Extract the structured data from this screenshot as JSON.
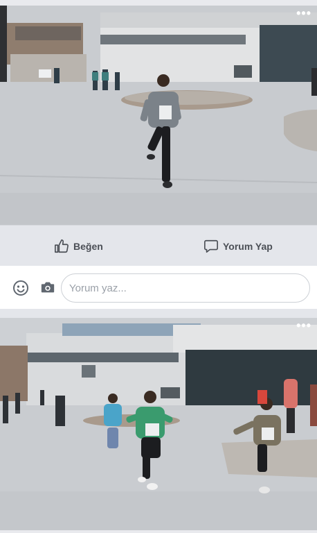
{
  "post1": {
    "photo_alt": "Children running on a paved plaza in front of a building",
    "more_label": "•••"
  },
  "actions": {
    "like_label": "Beğen",
    "comment_label": "Yorum Yap"
  },
  "comment_box": {
    "placeholder": "Yorum yaz..."
  },
  "post2": {
    "more_label": "•••"
  },
  "icons": {
    "like": "thumbs-up-icon",
    "comment": "speech-bubble-icon",
    "emoji": "smiley-icon",
    "camera": "camera-icon",
    "more": "more-dots-icon"
  }
}
